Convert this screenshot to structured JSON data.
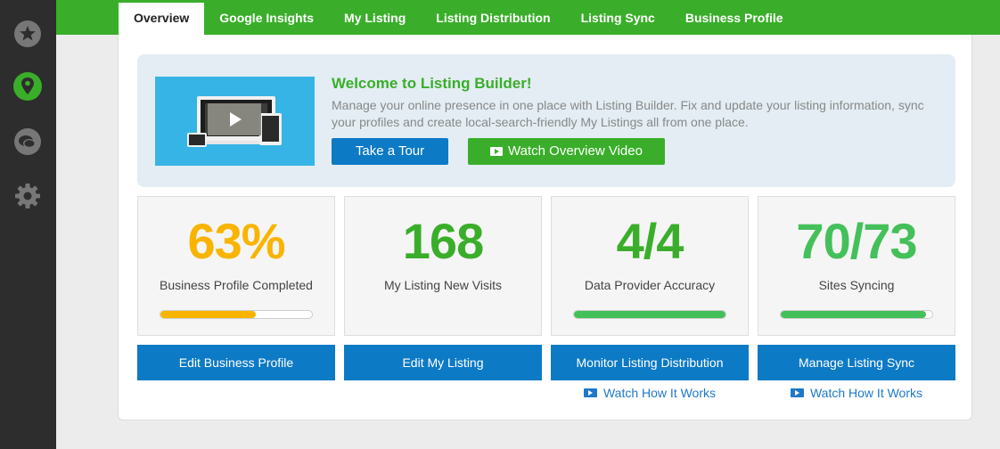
{
  "sidebar": {
    "icons": [
      "star-icon",
      "location-pin-icon",
      "chat-bubble-icon",
      "gear-icon"
    ],
    "active": "location-pin-icon"
  },
  "nav": {
    "tabs": [
      "Overview",
      "Google Insights",
      "My Listing",
      "Listing Distribution",
      "Listing Sync",
      "Business Profile"
    ],
    "active": "Overview"
  },
  "welcome": {
    "title": "Welcome to Listing Builder!",
    "text": "Manage your online presence in one place with Listing Builder. Fix and update your listing information, sync your profiles and create local-search-friendly My Listings all from one place.",
    "tour_label": "Take a Tour",
    "video_label": "Watch Overview Video"
  },
  "stats": [
    {
      "value": "63%",
      "label": "Business Profile Completed",
      "progress": 0.63,
      "color": "#f9b400",
      "bar_color": "#f9b400"
    },
    {
      "value": "168",
      "label": "My Listing New Visits",
      "color": "#3aae2a"
    },
    {
      "value": "4/4",
      "label": "Data Provider Accuracy",
      "progress": 1.0,
      "color": "#3aae2a",
      "bar_color": "#44c05a"
    },
    {
      "value": "70/73",
      "label": "Sites Syncing",
      "progress": 0.96,
      "color": "#44c05a",
      "bar_color": "#44c05a"
    }
  ],
  "actions": [
    {
      "label": "Edit Business Profile"
    },
    {
      "label": "Edit My Listing"
    },
    {
      "label": "Monitor Listing Distribution",
      "link": "Watch How It Works"
    },
    {
      "label": "Manage Listing Sync",
      "link": "Watch How It Works"
    }
  ],
  "colors": {
    "brand_green": "#3aae2a",
    "action_blue": "#0d7ac5",
    "rail": "#2d2d2d"
  }
}
